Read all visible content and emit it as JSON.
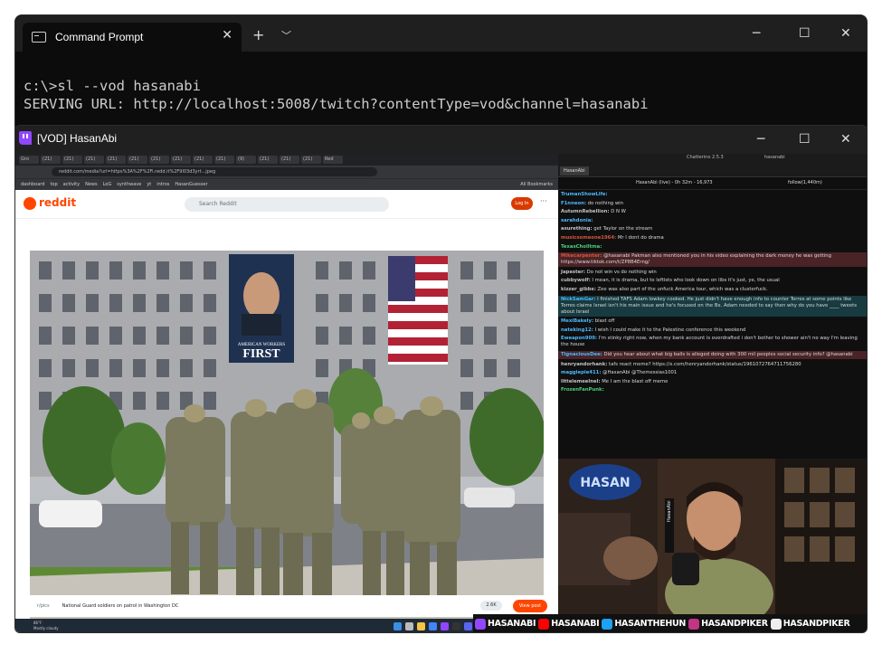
{
  "terminal": {
    "tab_title": "Command Prompt",
    "new_tab_icon": "+",
    "dropdown_icon": "chevron-down",
    "lines": [
      "c:\\>sl --vod hasanabi",
      "SERVING URL: http://localhost:5008/twitch?contentType=vod&channel=hasanabi"
    ]
  },
  "vod_window": {
    "title": "[VOD] HasanAbi"
  },
  "browser": {
    "tabs": [
      "Gro",
      "(21)",
      "(21)",
      "(21)",
      "(21)",
      "(21)",
      "(21)",
      "(21)",
      "(21)",
      "(21)",
      "(9)",
      "(21)",
      "(21)",
      "(21)",
      "Red"
    ],
    "url": "reddit.com/media?url=https%3A%2F%2Fi.redd.it%2F9l03d3yrt...jpeg",
    "bookmarks": [
      "dashboard",
      "top",
      "activity",
      "News",
      "LoG",
      "synthwave",
      "yt",
      "intros",
      "HasanGuesser"
    ],
    "all_bookmarks": "All Bookmarks"
  },
  "reddit": {
    "logo_text": "reddit",
    "search_placeholder": "Search Reddit",
    "login_label": "Log In",
    "post_subreddit": "r/pics",
    "post_title": "National Guard soldiers on patrol in Washington DC",
    "comments": "2.6K",
    "view_post": "View post",
    "banner_text_1": "AMERICAN WORKERS",
    "banner_text_2": "FIRST"
  },
  "taskbar": {
    "temp": "86°F",
    "weather": "Mostly cloudy"
  },
  "chat": {
    "app": "Chatterino 2.5.3",
    "channel": "hasanabi",
    "tab": "HasanAbi",
    "status": "HasanAbi (live) - 0h 32m - 16,973",
    "followers": "follow(1,440m)",
    "messages": [
      {
        "user": "TrumanShowLife:",
        "color": "#4cb9ff",
        "text": "",
        "hl": ""
      },
      {
        "user": "F1nneon:",
        "color": "#4cb9ff",
        "text": "do nothing win",
        "hl": ""
      },
      {
        "user": "AutumnRebellion:",
        "color": "#c3c3c3",
        "text": "D N W",
        "hl": ""
      },
      {
        "user": "sarahdonia:",
        "color": "#4cb9ff",
        "text": "",
        "hl": ""
      },
      {
        "user": "asurething:",
        "color": "#c3c3c3",
        "text": "get Taylor on the stream",
        "hl": ""
      },
      {
        "user": "musicsomeone1964:",
        "color": "#d5573b",
        "text": "Mr I dont do drama",
        "hl": ""
      },
      {
        "user": "TexasCholltma:",
        "color": "#4ad07a",
        "text": "",
        "hl": ""
      },
      {
        "user": "Mikecarpenter:",
        "color": "#d5573b",
        "text": "@hasanabi Pakman also mentioned you in his video explaining the dark money he was getting https://www.tiktok.com/t/ZP8B4Erng/",
        "hl": "hl"
      },
      {
        "user": "Japester:",
        "color": "#c3c3c3",
        "text": "Do not win vs do nothing win",
        "hl": ""
      },
      {
        "user": "cubbywolf:",
        "color": "#c3c3c3",
        "text": "I mean, it is drama, but to leftists who look down on libs it's just, ye, the usual",
        "hl": ""
      },
      {
        "user": "kizzer_gibbs:",
        "color": "#c3c3c3",
        "text": "Zee was also part of the unfuck America tour, which was a clusterfuck.",
        "hl": ""
      },
      {
        "user": "NickSamGar:",
        "color": "#4cb9ff",
        "text": "I finished TAFS Adam lowkey cooked. He just didn't have enough info to counter Torres at some points like Torres claims Israel isn't his main issue and he's focused on the Bx. Adam needed to say then why do you have ____ tweets about Israel",
        "hl": "hl2"
      },
      {
        "user": "MexiBakely:",
        "color": "#4cb9ff",
        "text": "blast off",
        "hl": ""
      },
      {
        "user": "nateking12:",
        "color": "#4cb9ff",
        "text": "I wish I could make it to the Palestine conference this weekend",
        "hl": ""
      },
      {
        "user": "Eweapon909:",
        "color": "#4cb9ff",
        "text": "I'm stinky right now, when my bank account is overdrafted i don't bother to shower ain't no way I'm leaving the house",
        "hl": ""
      },
      {
        "user": "TignaciousDee:",
        "color": "#4cb9ff",
        "text": "Did you hear about what big balls is alleged doing with 300 mil peoples social security info? @hasanabi",
        "hl": "hl"
      },
      {
        "user": "henryandorhank:",
        "color": "#c3c3c3",
        "text": "tafs react meme? https://x.com/henryandorhank/status/1961072764711756280",
        "hl": ""
      },
      {
        "user": "maggiepie411:",
        "color": "#4cb9ff",
        "text": "@HasanAbi @Themessias1001",
        "hl": ""
      },
      {
        "user": "littelemeelnel:",
        "color": "#c3c3c3",
        "text": "Me I am the blast off meme",
        "hl": ""
      },
      {
        "user": "FrozenFanPunk:",
        "color": "#4ad07a",
        "text": "",
        "hl": ""
      }
    ]
  },
  "webcam": {
    "sign_text": "HASAN",
    "mic_label": "HasanAbi"
  },
  "social": [
    {
      "icon": "twitch-icon",
      "color": "#9146ff",
      "handle": "HASANABI"
    },
    {
      "icon": "youtube-icon",
      "color": "#ff0000",
      "handle": "HASANABI"
    },
    {
      "icon": "twitter-icon",
      "color": "#1da1f2",
      "handle": "HASANTHEHUN"
    },
    {
      "icon": "instagram-icon",
      "color": "#c13584",
      "handle": "HASANDPIKER"
    },
    {
      "icon": "tiktok-icon",
      "color": "#eeeeee",
      "handle": "HASANDPIKER"
    }
  ],
  "colors": {
    "reddit": "#ff4500",
    "twitch": "#9146ff",
    "terminal_bg": "#0c0c0c"
  }
}
